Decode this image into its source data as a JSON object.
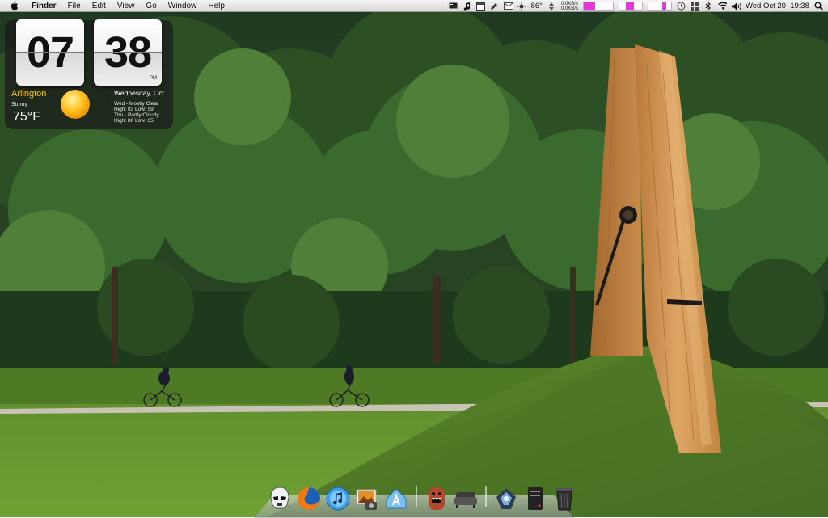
{
  "menubar": {
    "apple_icon": "apple-logo",
    "app_name": "Finder",
    "menus": [
      "File",
      "Edit",
      "View",
      "Go",
      "Window",
      "Help"
    ],
    "status": {
      "temperature": "86°",
      "net_up": "0.0KB/s",
      "net_down": "0.0KB/s",
      "clock": "Wed Oct 20  19:38",
      "icons": [
        "screen-icon",
        "music-note-icon",
        "calendar-icon",
        "pen-icon",
        "mail-icon",
        "sun-icon",
        "cpu-meter-icon",
        "memory-meter-icon",
        "disk-meter-icon",
        "time-machine-icon",
        "grid-icon",
        "bluetooth-icon",
        "wifi-icon",
        "volume-icon",
        "spotlight-icon"
      ]
    }
  },
  "clock_widget": {
    "hours": "07",
    "minutes": "38",
    "ampm": "PM",
    "city": "Arlington",
    "condition": "Sunny",
    "temperature": "75°F",
    "date": "Wednesday, Oct",
    "forecast": [
      {
        "line1": "Wed - Mostly Clear",
        "line2": "High: 83 Low: 59"
      },
      {
        "line1": "Thu - Partly Cloudy",
        "line2": "High: 86 Low: 65"
      }
    ]
  },
  "dock": {
    "apps": [
      "stormtrooper-icon",
      "firefox-icon",
      "itunes-icon",
      "iphoto-icon",
      "app-store-icon",
      "domo-icon",
      "sofa-icon",
      "network-icon",
      "server-icon",
      "trash-icon"
    ]
  },
  "colors": {
    "widget_city": "#f0c419",
    "meter_fill": "#e23ad8"
  }
}
